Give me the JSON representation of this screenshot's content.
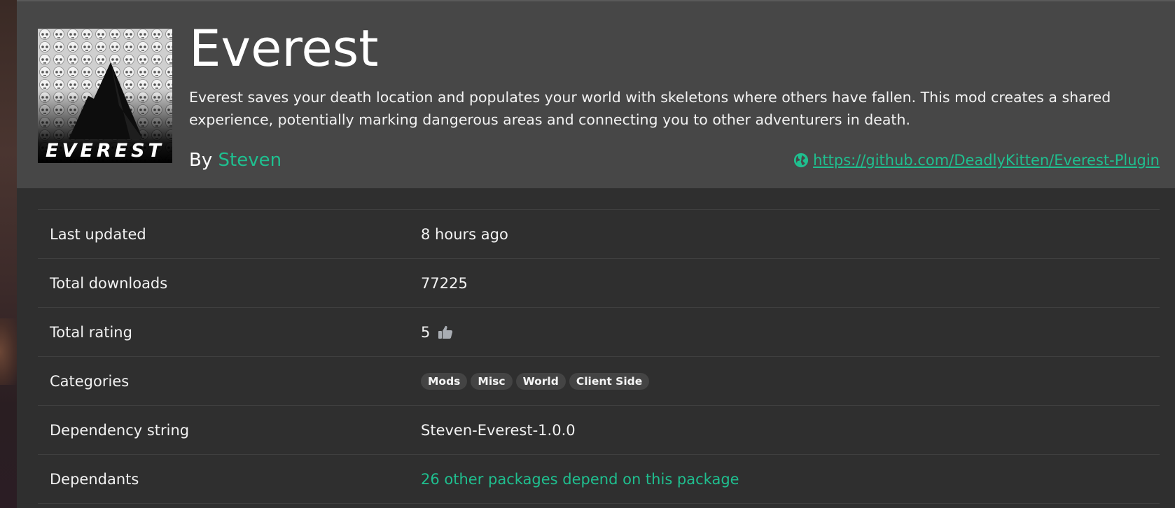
{
  "package": {
    "name": "Everest",
    "logo_text": "EVEREST",
    "description": "Everest saves your death location and populates your world with skeletons where others have fallen. This mod creates a shared experience, potentially marking dangerous areas and connecting you to other adventurers in death.",
    "by_prefix": "By",
    "author": "Steven",
    "website_url": "https://github.com/DeadlyKitten/Everest-Plugin"
  },
  "details": {
    "last_updated_label": "Last updated",
    "last_updated_value": "8 hours ago",
    "total_downloads_label": "Total downloads",
    "total_downloads_value": "77225",
    "total_rating_label": "Total rating",
    "total_rating_value": "5",
    "categories_label": "Categories",
    "categories": [
      "Mods",
      "Misc",
      "World",
      "Client Side"
    ],
    "dependency_string_label": "Dependency string",
    "dependency_string_value": "Steven-Everest-1.0.0",
    "dependants_label": "Dependants",
    "dependants_value": "26 other packages depend on this package"
  },
  "colors": {
    "accent": "#1fbf8f",
    "header_bg": "#474747",
    "body_bg": "#2f2f2f",
    "tag_bg": "#444444"
  },
  "icons": {
    "website": "globe-icon",
    "rating": "thumbs-up-icon"
  }
}
